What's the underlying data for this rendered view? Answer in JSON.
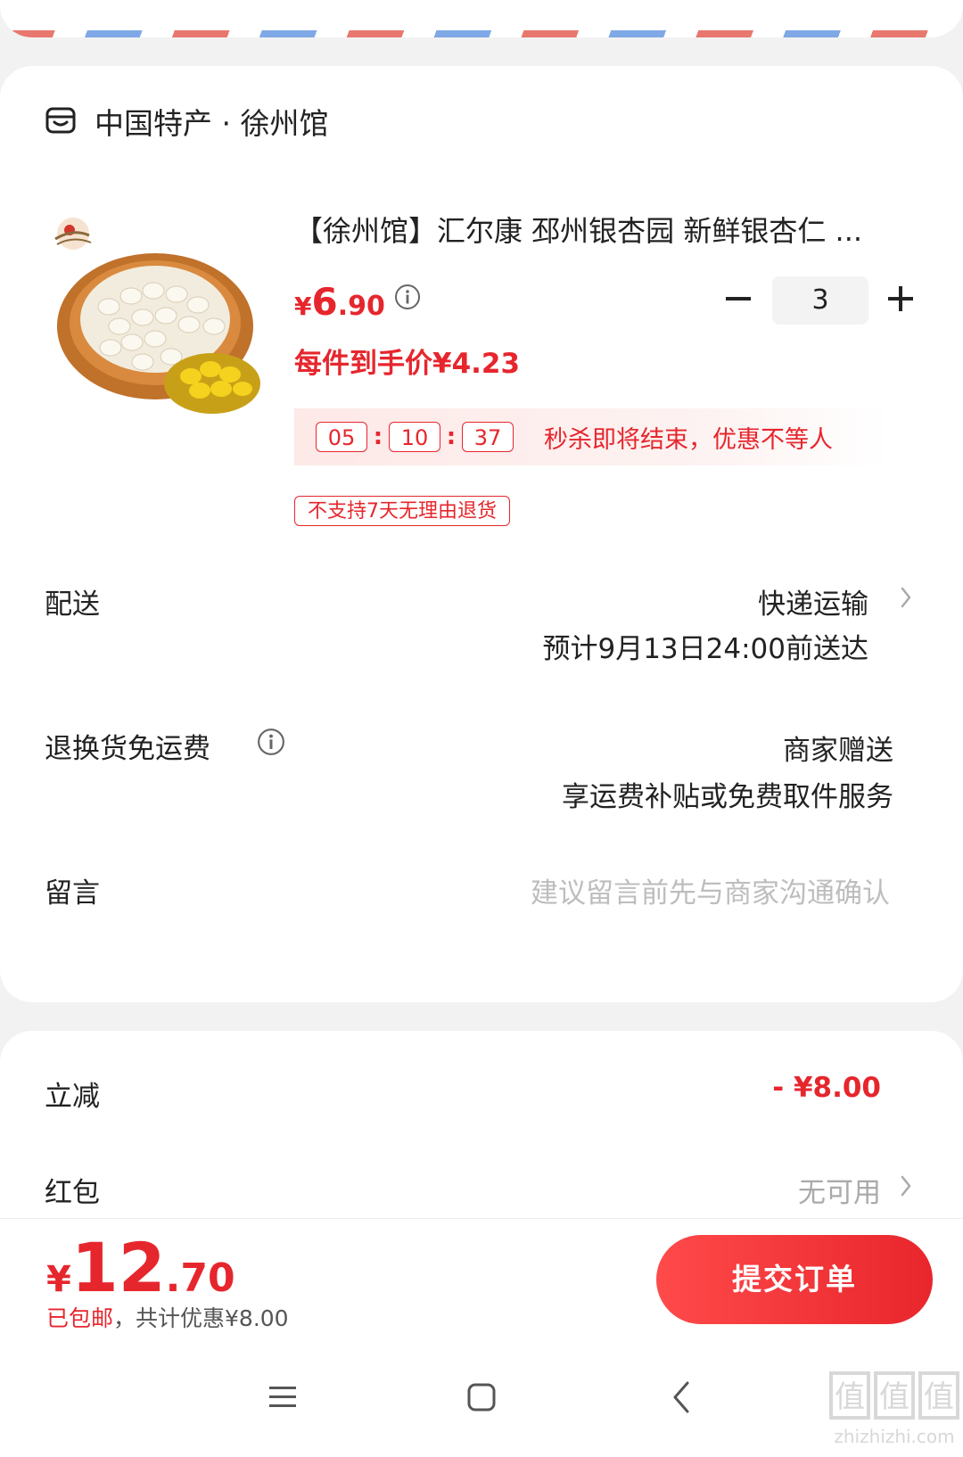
{
  "shop": {
    "name": "中国特产 · 徐州馆",
    "icon": "shop-icon"
  },
  "product": {
    "title": "【徐州馆】汇尔康 邳州银杏园 新鲜银杏仁 ...",
    "image_alt": "basket of fresh ginkgo nuts",
    "price_currency": "¥",
    "price_int": "6",
    "price_dec": ".90",
    "quantity": "3",
    "per_item_price": "每件到手价¥4.23",
    "countdown": {
      "hours": "05",
      "minutes": "10",
      "seconds": "37",
      "sep": ":",
      "text": "秒杀即将结束，优惠不等人"
    },
    "return_tag": "不支持7天无理由退货"
  },
  "delivery": {
    "label": "配送",
    "method": "快递运输",
    "eta": "预计9月13日24:00前送达"
  },
  "return_shipping": {
    "label": "退换货免运费",
    "value": "商家赠送",
    "desc": "享运费补贴或免费取件服务"
  },
  "message": {
    "label": "留言",
    "placeholder": "建议留言前先与商家沟通确认"
  },
  "discount": {
    "label": "立减",
    "value": "- ¥8.00"
  },
  "red_packet": {
    "label": "红包",
    "value": "无可用"
  },
  "total": {
    "currency": "¥",
    "int": "12",
    "dec": ".70",
    "shipping": "已包邮",
    "savings": "，共计优惠¥8.00"
  },
  "submit_label": "提交订单",
  "nav": [
    "menu-icon",
    "home-icon",
    "back-icon"
  ],
  "watermark": {
    "text": "值",
    "site": "zhizhizhi.com"
  },
  "colors": {
    "accent": "#e6262d",
    "stripe_red": "#e8786e",
    "stripe_blue": "#7fa8e6"
  }
}
